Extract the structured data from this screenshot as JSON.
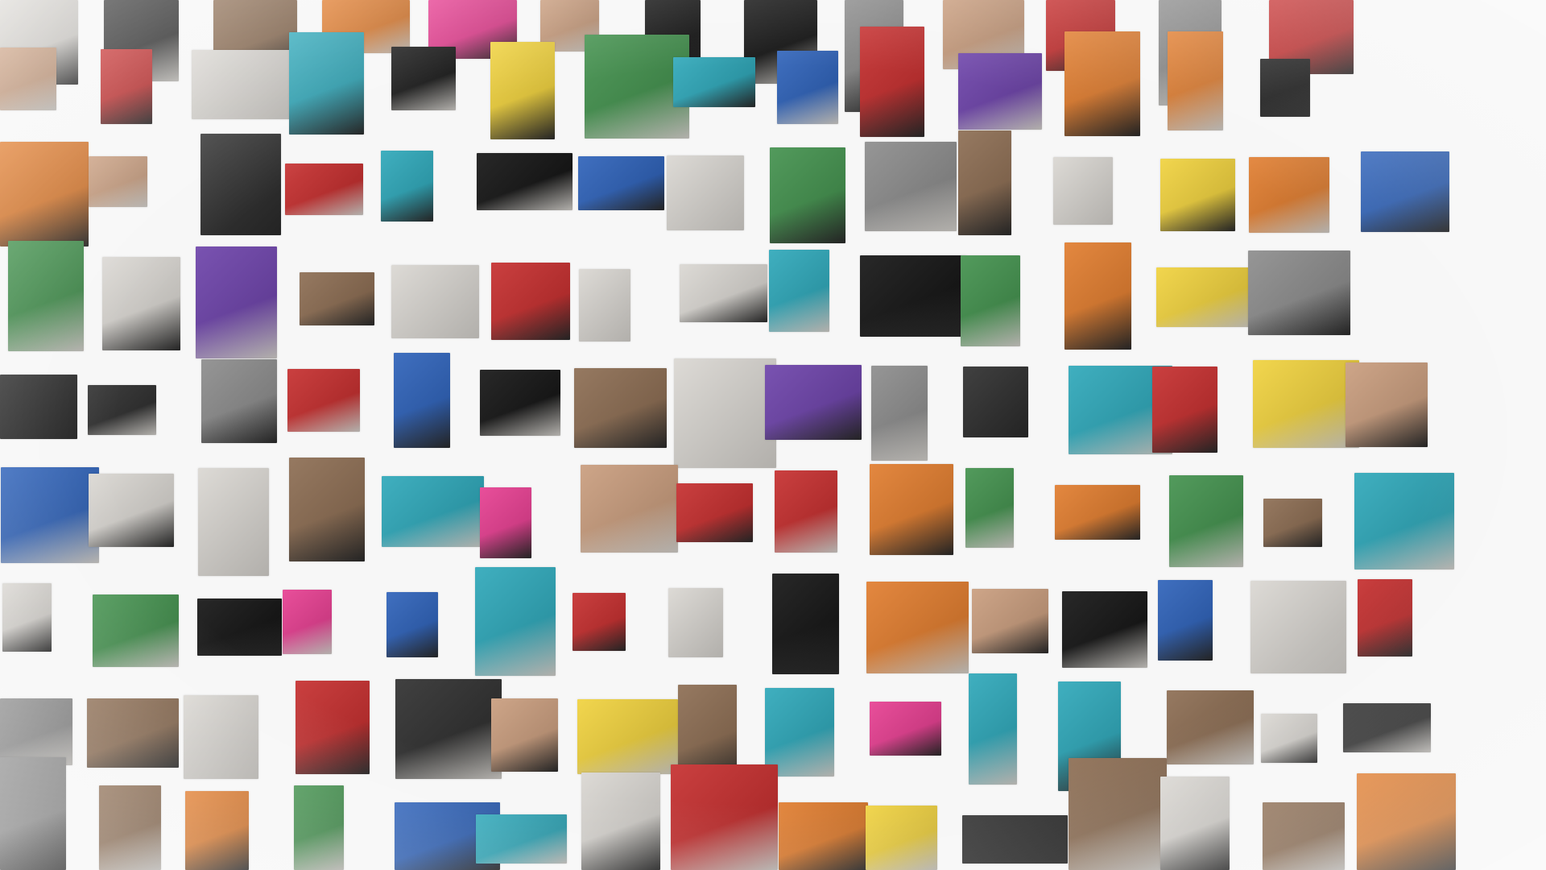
{
  "gallery": {
    "palette": {
      "black": "#101010",
      "charcoal": "#2b2b2b",
      "gray": "#8a8a8a",
      "light": "#d9d6d1",
      "sepia": "#8a6a4f",
      "skin": "#c89b7b",
      "red": "#c42a2a",
      "pink": "#e63b8f",
      "yellow": "#f0d13a",
      "teal": "#2aa6b8",
      "blue": "#2a5fb8",
      "green": "#3f8f4a",
      "purple": "#6a3fa8",
      "orange": "#e07a2a"
    },
    "rows": [
      [
        "light",
        "charcoal",
        "sepia",
        "orange",
        "pink",
        "skin",
        "black",
        "black",
        "gray",
        "skin",
        "red",
        "gray",
        "red"
      ],
      [
        "skin",
        "red",
        "light",
        "teal",
        "black",
        "yellow",
        "green",
        "teal",
        "blue",
        "red",
        "purple",
        "orange",
        "orange",
        "black"
      ],
      [
        "orange",
        "skin",
        "charcoal",
        "red",
        "teal",
        "black",
        "blue",
        "light",
        "green",
        "gray",
        "sepia",
        "light",
        "yellow",
        "orange",
        "blue"
      ],
      [
        "green",
        "light",
        "purple",
        "sepia",
        "light",
        "red",
        "light",
        "light",
        "teal",
        "black",
        "green",
        "orange",
        "yellow",
        "gray"
      ],
      [
        "charcoal",
        "charcoal",
        "gray",
        "red",
        "blue",
        "black",
        "sepia",
        "light",
        "purple",
        "gray",
        "charcoal",
        "teal",
        "red",
        "yellow",
        "skin"
      ],
      [
        "blue",
        "light",
        "light",
        "sepia",
        "teal",
        "pink",
        "skin",
        "red",
        "red",
        "orange",
        "green",
        "orange",
        "green",
        "sepia",
        "teal"
      ],
      [
        "light",
        "green",
        "black",
        "pink",
        "blue",
        "teal",
        "red",
        "light",
        "black",
        "orange",
        "skin",
        "black",
        "blue",
        "light",
        "red"
      ],
      [
        "gray",
        "sepia",
        "light",
        "red",
        "charcoal",
        "skin",
        "yellow",
        "sepia",
        "teal",
        "pink",
        "teal",
        "teal",
        "sepia",
        "light",
        "charcoal"
      ],
      [
        "gray",
        "sepia",
        "orange",
        "green",
        "blue",
        "teal",
        "light",
        "red",
        "orange",
        "yellow",
        "charcoal",
        "sepia",
        "light",
        "sepia",
        "orange"
      ]
    ]
  }
}
